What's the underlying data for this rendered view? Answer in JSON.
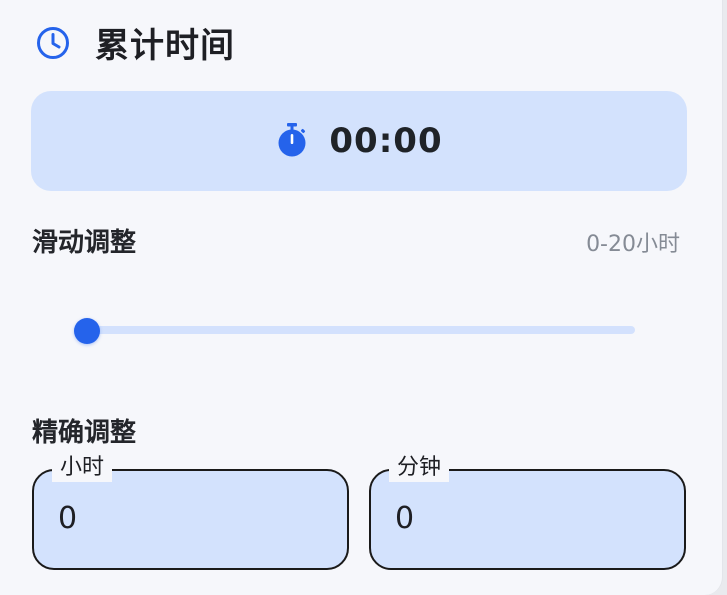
{
  "header": {
    "title": "累计时间",
    "icon": "clock-icon"
  },
  "timer": {
    "display": "00:00",
    "icon": "stopwatch-icon"
  },
  "slider_section": {
    "label": "滑动调整",
    "range_hint": "0-20小时",
    "value_hours": 0,
    "min_hours": 0,
    "max_hours": 20
  },
  "fine_section": {
    "label": "精确调整",
    "hours": {
      "label": "小时",
      "value": "0"
    },
    "minutes": {
      "label": "分钟",
      "value": "0"
    }
  },
  "colors": {
    "accent": "#2563eb",
    "surface_blue": "#d3e2fd",
    "background": "#f6f7fb"
  }
}
